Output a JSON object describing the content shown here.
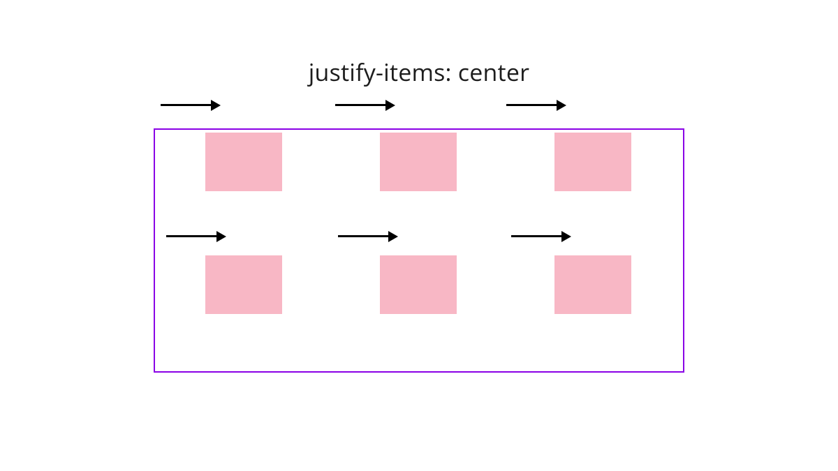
{
  "title": "justify-items: center",
  "grid": {
    "columns": 3,
    "rows": 2,
    "border_color": "#8a00e6",
    "dash_color": "#9b4dff",
    "item_color": "#f8b7c5"
  },
  "items": [
    {
      "row": 1,
      "col": 1
    },
    {
      "row": 1,
      "col": 2
    },
    {
      "row": 1,
      "col": 3
    },
    {
      "row": 2,
      "col": 1
    },
    {
      "row": 2,
      "col": 2
    },
    {
      "row": 2,
      "col": 3
    }
  ],
  "arrows": {
    "direction": "right",
    "top_row": 3,
    "mid_row": 3
  }
}
